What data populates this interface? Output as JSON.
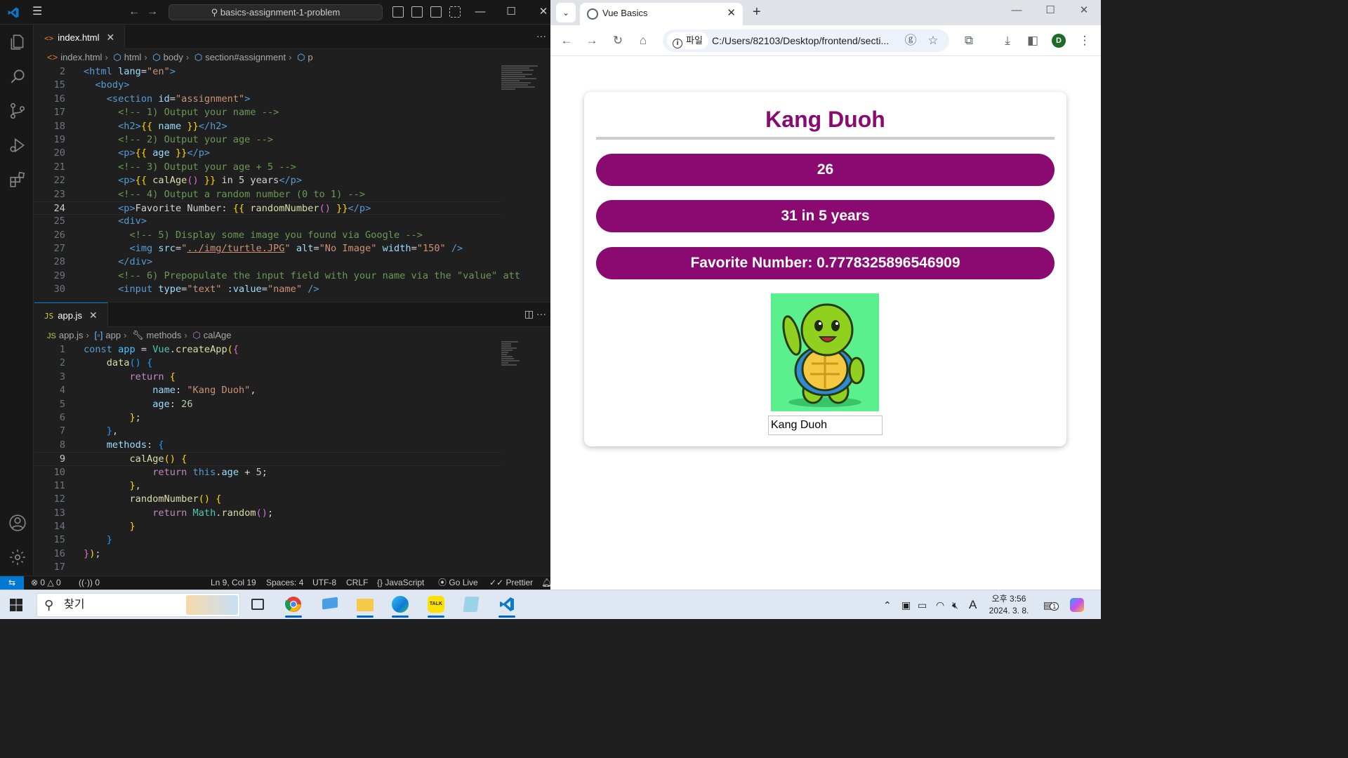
{
  "vscode": {
    "title_search": "basics-assignment-1-problem",
    "top_editor": {
      "tab_icon": "<>",
      "tab_label": "index.html",
      "breadcrumb": [
        "index.html",
        "html",
        "body",
        "section#assignment",
        "p"
      ],
      "lines": [
        {
          "n": "2",
          "html": "<span class='c-tag'>&lt;html</span> <span class='c-attr'>lang</span><span class='c-txt'>=</span><span class='c-str'>\"en\"</span><span class='c-tag'>&gt;</span>"
        },
        {
          "n": "15",
          "html": "  <span class='c-tag'>&lt;body&gt;</span>"
        },
        {
          "n": "16",
          "html": "    <span class='c-tag'>&lt;section</span> <span class='c-attr'>id</span><span class='c-txt'>=</span><span class='c-str'>\"assignment\"</span><span class='c-tag'>&gt;</span>"
        },
        {
          "n": "17",
          "html": "      <span class='c-com'>&lt;!-- 1) Output your name --&gt;</span>"
        },
        {
          "n": "18",
          "html": "      <span class='c-tag'>&lt;h2&gt;</span><span class='c-br'>{{</span><span class='c-txt'> </span><span class='c-prop'>name</span><span class='c-txt'> </span><span class='c-br'>}}</span><span class='c-tag'>&lt;/h2&gt;</span>"
        },
        {
          "n": "19",
          "html": "      <span class='c-com'>&lt;!-- 2) Output your age --&gt;</span>"
        },
        {
          "n": "20",
          "html": "      <span class='c-tag'>&lt;p&gt;</span><span class='c-br'>{{</span><span class='c-txt'> </span><span class='c-prop'>age</span><span class='c-txt'> </span><span class='c-br'>}}</span><span class='c-tag'>&lt;/p&gt;</span>"
        },
        {
          "n": "21",
          "html": "      <span class='c-com'>&lt;!-- 3) Output your age + 5 --&gt;</span>"
        },
        {
          "n": "22",
          "html": "      <span class='c-tag'>&lt;p&gt;</span><span class='c-br'>{{</span><span class='c-txt'> </span><span class='c-fn'>calAge</span><span class='c-br2'>()</span><span class='c-txt'> </span><span class='c-br'>}}</span><span class='c-txt'> in 5 years</span><span class='c-tag'>&lt;/p&gt;</span>"
        },
        {
          "n": "23",
          "html": "      <span class='c-com'>&lt;!-- 4) Output a random number (0 to 1) --&gt;</span>"
        },
        {
          "n": "24",
          "cur": true,
          "html": "      <span class='c-tag'>&lt;p&gt;</span><span class='c-txt'>Favorite Number: </span><span class='c-br'>{{</span><span class='c-txt'> </span><span class='c-fn'>randomNumber</span><span class='c-br2'>()</span><span class='c-txt'> </span><span class='c-br'>}}</span><span class='c-tag'>&lt;/p&gt;</span>"
        },
        {
          "n": "25",
          "html": "      <span class='c-tag'>&lt;div&gt;</span>"
        },
        {
          "n": "26",
          "html": "        <span class='c-com'>&lt;!-- 5) Display some image you found via Google --&gt;</span>"
        },
        {
          "n": "27",
          "html": "        <span class='c-tag'>&lt;img</span> <span class='c-attr'>src</span><span class='c-txt'>=</span><span class='c-str'>\"<u>../img/turtle.JPG</u>\"</span> <span class='c-attr'>alt</span><span class='c-txt'>=</span><span class='c-str'>\"No Image\"</span> <span class='c-attr'>width</span><span class='c-txt'>=</span><span class='c-str'>\"150\"</span> <span class='c-tag'>/&gt;</span>"
        },
        {
          "n": "28",
          "html": "      <span class='c-tag'>&lt;/div&gt;</span>"
        },
        {
          "n": "29",
          "html": "      <span class='c-com'>&lt;!-- 6) Prepopulate the input field with your name via the \"value\" att</span>"
        },
        {
          "n": "30",
          "html": "      <span class='c-tag'>&lt;input</span> <span class='c-attr'>type</span><span class='c-txt'>=</span><span class='c-str'>\"text\"</span> <span class='c-attr'>:value</span><span class='c-txt'>=</span><span class='c-str'>\"name\"</span> <span class='c-tag'>/&gt;</span>"
        }
      ]
    },
    "bottom_editor": {
      "tab_icon": "JS",
      "tab_label": "app.js",
      "breadcrumb": [
        "app.js",
        "app",
        "methods",
        "calAge"
      ],
      "lines": [
        {
          "n": "1",
          "html": "<span class='c-kw'>const</span> <span class='c-var'>app</span> <span class='c-txt'>=</span> <span class='c-cls'>Vue</span><span class='c-txt'>.</span><span class='c-fn'>createApp</span><span class='c-br'>(</span><span class='c-br2'>{</span>"
        },
        {
          "n": "2",
          "html": "    <span class='c-fn'>data</span><span class='c-br3'>()</span> <span class='c-br3'>{</span>"
        },
        {
          "n": "3",
          "html": "        <span class='c-ret'>return</span> <span class='c-br'>{</span>"
        },
        {
          "n": "4",
          "html": "            <span class='c-prop'>name</span><span class='c-txt'>: </span><span class='c-str'>\"Kang Duoh\"</span><span class='c-txt'>,</span>"
        },
        {
          "n": "5",
          "html": "            <span class='c-prop'>age</span><span class='c-txt'>: </span><span class='c-num'>26</span>"
        },
        {
          "n": "6",
          "html": "        <span class='c-br'>}</span><span class='c-txt'>;</span>"
        },
        {
          "n": "7",
          "html": "    <span class='c-br3'>}</span><span class='c-txt'>,</span>"
        },
        {
          "n": "8",
          "html": "    <span class='c-prop'>methods</span><span class='c-txt'>: </span><span class='c-br3'>{</span>"
        },
        {
          "n": "9",
          "cur": true,
          "html": "        <span class='c-fn'>calAge</span><span class='c-br'>()</span> <span class='c-br'>{</span>"
        },
        {
          "n": "10",
          "html": "            <span class='c-ret'>return</span> <span class='c-kw'>this</span><span class='c-txt'>.</span><span class='c-prop'>age</span> <span class='c-txt'>+</span> <span class='c-num'>5</span><span class='c-txt'>;</span>"
        },
        {
          "n": "11",
          "html": "        <span class='c-br'>}</span><span class='c-txt'>,</span>"
        },
        {
          "n": "12",
          "html": "        <span class='c-fn'>randomNumber</span><span class='c-br'>()</span> <span class='c-br'>{</span>"
        },
        {
          "n": "13",
          "html": "            <span class='c-ret'>return</span> <span class='c-cls'>Math</span><span class='c-txt'>.</span><span class='c-fn'>random</span><span class='c-br2'>()</span><span class='c-txt'>;</span>"
        },
        {
          "n": "14",
          "html": "        <span class='c-br'>}</span>"
        },
        {
          "n": "15",
          "html": "    <span class='c-br3'>}</span>"
        },
        {
          "n": "16",
          "html": "<span class='c-br2'>}</span><span class='c-br'>)</span><span class='c-txt'>;</span>"
        },
        {
          "n": "17",
          "html": ""
        }
      ]
    },
    "status": {
      "errors": "0",
      "warnings": "0",
      "ports": "0",
      "position": "Ln 9, Col 19",
      "spaces": "Spaces: 4",
      "encoding": "UTF-8",
      "eol": "CRLF",
      "language": "JavaScript",
      "golive": "Go Live",
      "prettier": "Prettier"
    }
  },
  "chrome": {
    "tab_title": "Vue Basics",
    "info_label": "파일",
    "url": "C:/Users/82103/Desktop/frontend/secti...",
    "avatar_letter": "D",
    "page": {
      "name": "Kang Duoh",
      "age": "26",
      "age_plus": "31 in 5 years",
      "favorite": "Favorite Number: 0.7778325896546909",
      "input_value": "Kang Duoh",
      "accent": "#8b0a72"
    }
  },
  "taskbar": {
    "search_text": "찾기",
    "time": "오후 3:56",
    "date": "2024. 3. 8.",
    "ime": "A",
    "notif_count": "1"
  }
}
